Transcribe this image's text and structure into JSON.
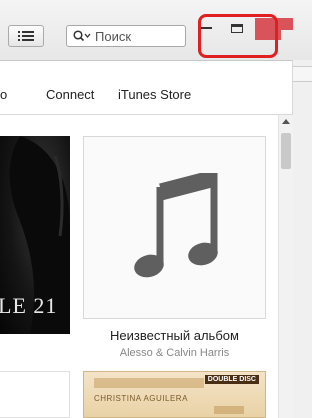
{
  "toolbar": {
    "view_icon": "list-icon",
    "search": {
      "placeholder": "Поиск",
      "icon": "search-icon"
    }
  },
  "window_controls": {
    "minimize_icon": "minimize-icon",
    "maximize_icon": "maximize-icon",
    "close_icon": "close-icon",
    "close_color": "#d9545a",
    "highlight_color": "#e02020"
  },
  "nav": {
    "items": [
      {
        "label": "o"
      },
      {
        "label": "Connect"
      },
      {
        "label": "iTunes Store"
      }
    ]
  },
  "albums": {
    "left_cover_text": "LE 21",
    "main": {
      "title": "Неизвестный альбом",
      "artist": "Alesso & Calvin Harris",
      "icon": "music-note-icon"
    },
    "bottom": {
      "text": "CHRISTINA AGUILERA",
      "badge": "DOUBLE DISC"
    }
  }
}
